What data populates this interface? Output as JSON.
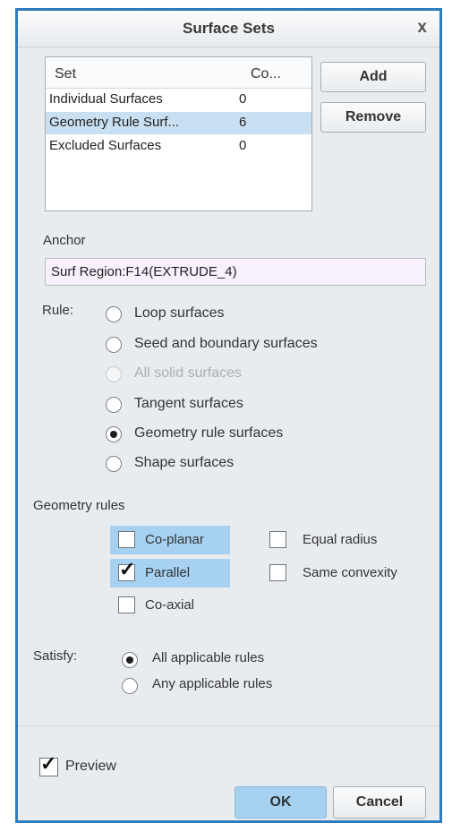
{
  "dialog": {
    "title": "Surface Sets",
    "close_symbol": "x"
  },
  "set_list": {
    "headers": {
      "set": "Set",
      "count": "Co..."
    },
    "rows": [
      {
        "name": "Individual Surfaces",
        "count": "0",
        "selected": false
      },
      {
        "name": "Geometry Rule Surf...",
        "count": "6",
        "selected": true
      },
      {
        "name": "Excluded Surfaces",
        "count": "0",
        "selected": false
      }
    ]
  },
  "buttons": {
    "add": "Add",
    "remove": "Remove",
    "ok": "OK",
    "cancel": "Cancel"
  },
  "anchor": {
    "label": "Anchor",
    "value": "Surf Region:F14(EXTRUDE_4)"
  },
  "rule": {
    "label": "Rule:",
    "options": [
      {
        "label": "Loop surfaces",
        "checked": false,
        "disabled": false
      },
      {
        "label": "Seed and boundary surfaces",
        "checked": false,
        "disabled": false
      },
      {
        "label": "All solid surfaces",
        "checked": false,
        "disabled": true
      },
      {
        "label": "Tangent surfaces",
        "checked": false,
        "disabled": false
      },
      {
        "label": "Geometry rule surfaces",
        "checked": true,
        "disabled": false
      },
      {
        "label": "Shape surfaces",
        "checked": false,
        "disabled": false
      }
    ]
  },
  "geometry_rules": {
    "label": "Geometry rules",
    "co_planar": {
      "label": "Co-planar",
      "checked": false
    },
    "parallel": {
      "label": "Parallel",
      "checked": true
    },
    "co_axial": {
      "label": "Co-axial",
      "checked": false
    },
    "equal_radius": {
      "label": "Equal radius",
      "checked": false
    },
    "same_convexity": {
      "label": "Same convexity",
      "checked": false
    }
  },
  "satisfy": {
    "label": "Satisfy:",
    "options": [
      {
        "label": "All applicable rules",
        "checked": true
      },
      {
        "label": "Any applicable rules",
        "checked": false
      }
    ]
  },
  "preview": {
    "label": "Preview",
    "checked": true
  },
  "colors": {
    "border": "#2f7bbd",
    "selection": "#c8e0f2",
    "highlight": "#a6d1f1",
    "ok_button": "#a6d1f1"
  }
}
